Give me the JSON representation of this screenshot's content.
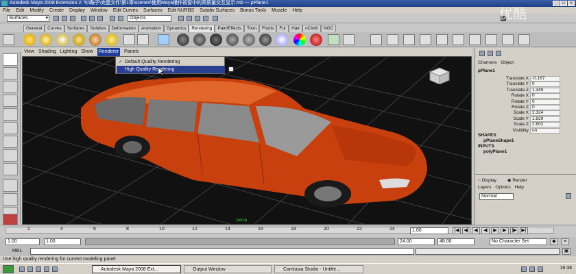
{
  "window": {
    "title": "Autodesk Maya 2008 Extension 2: ％\\鞍子\\完蛋文件\\第1章\\scenes\\使用Maya播作视窗中的高质量交互显示.mb  ---  pPlane1",
    "controls": [
      "_",
      "□",
      "×"
    ]
  },
  "menubar": {
    "items": [
      "File",
      "Edit",
      "Modify",
      "Create",
      "Display",
      "Window",
      "Edit Curves",
      "Surfaces",
      "Edit NURBS",
      "Subdiv Surfaces",
      "Bonus Tools",
      "Muscle",
      "Help"
    ]
  },
  "statusline": {
    "mode": "Surfaces",
    "object_field": "Objects"
  },
  "shelf": {
    "tabs": [
      "General",
      "Curves",
      "Surfaces",
      "Subdivs",
      "Deformation",
      "Animation",
      "Dynamics",
      "Rendering",
      "PaintEffects",
      "Toon",
      "Fluids",
      "Fur",
      "Hair",
      "nCloth",
      "NGC"
    ],
    "active_tab": "Rendering"
  },
  "panel": {
    "menu": [
      "View",
      "Shading",
      "Lighting",
      "Show",
      "Renderer",
      "Panels"
    ],
    "active_menu": "Renderer"
  },
  "renderer_menu": {
    "items": [
      {
        "label": "Default Quality Rendering",
        "checked": true
      },
      {
        "label": "High Quality Rendering",
        "checked": false,
        "highlighted": true
      }
    ]
  },
  "viewport": {
    "car_color": "#c8400e",
    "grid_color": "#5a5a5a",
    "axis_label": "persp"
  },
  "channelbox": {
    "tabs": [
      "Channels",
      "Object"
    ],
    "object_name": "pPlane1",
    "attributes": [
      {
        "name": "Translate X",
        "value": "-0.167"
      },
      {
        "name": "Translate Y",
        "value": "0"
      },
      {
        "name": "Translate Z",
        "value": "1.349"
      },
      {
        "name": "Rotate X",
        "value": "0"
      },
      {
        "name": "Rotate Y",
        "value": "0"
      },
      {
        "name": "Rotate Z",
        "value": "0"
      },
      {
        "name": "Scale X",
        "value": "2.324"
      },
      {
        "name": "Scale Y",
        "value": "1.829"
      },
      {
        "name": "Scale Z",
        "value": "2.602"
      },
      {
        "name": "Visibility",
        "value": "on"
      }
    ],
    "shapes_header": "SHAPES",
    "shape_name": "pPlaneShape1",
    "inputs_header": "INPUTS",
    "input_name": "polyPlane1"
  },
  "layers": {
    "display_label": "Display",
    "render_label": "Render",
    "menu": [
      "Layers",
      "Options",
      "Help"
    ],
    "type": "Normal"
  },
  "timeline": {
    "ticks": [
      "2",
      "4",
      "6",
      "8",
      "10",
      "12",
      "14",
      "16",
      "18",
      "20",
      "22",
      "24"
    ],
    "current_time": "1.00",
    "range_start": "1.00",
    "range_start_inner": "1.00",
    "range_end_inner": "24.00",
    "range_end": "48.00",
    "character_set": "No Character Set"
  },
  "cmdline": {
    "label": "MEL"
  },
  "helpline": {
    "text": "Use high quality rendering for current modeling panel"
  },
  "taskbar": {
    "tasks": [
      {
        "label": "Autodesk Maya 2008 Ext...",
        "active": true
      },
      {
        "label": "Output Window",
        "active": false
      },
      {
        "label": "Camtasia Studio - Untitle...",
        "active": false
      }
    ],
    "clock": "16:38"
  },
  "watermark": "优酷"
}
